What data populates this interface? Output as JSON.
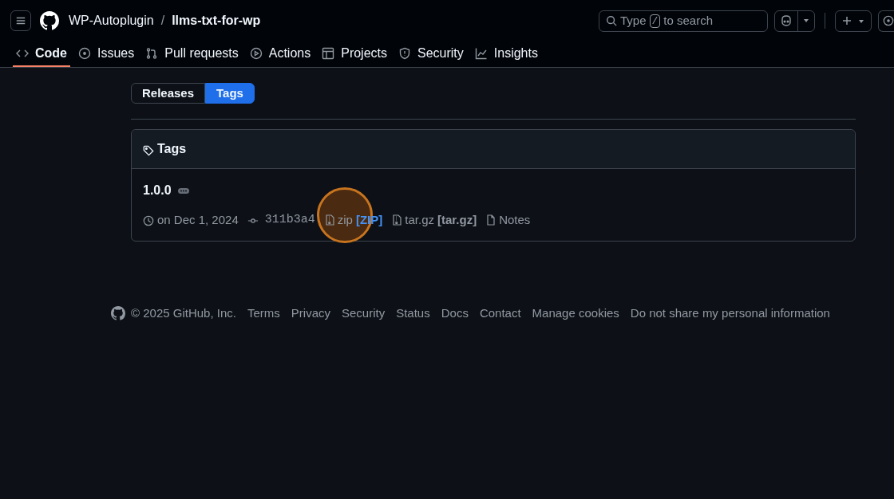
{
  "header": {
    "owner": "WP-Autoplugin",
    "separator": "/",
    "repo": "llms-txt-for-wp",
    "search": {
      "before": "Type",
      "key": "/",
      "after": "to search"
    }
  },
  "nav": [
    {
      "label": "Code",
      "kind": "code",
      "selected": true
    },
    {
      "label": "Issues",
      "kind": "issues",
      "selected": false
    },
    {
      "label": "Pull requests",
      "kind": "pulls",
      "selected": false
    },
    {
      "label": "Actions",
      "kind": "actions",
      "selected": false
    },
    {
      "label": "Projects",
      "kind": "projects",
      "selected": false
    },
    {
      "label": "Security",
      "kind": "security",
      "selected": false
    },
    {
      "label": "Insights",
      "kind": "insights",
      "selected": false
    }
  ],
  "switcher": [
    {
      "label": "Releases",
      "selected": false
    },
    {
      "label": "Tags",
      "selected": true
    }
  ],
  "tags_box": {
    "title": "Tags",
    "tags": [
      {
        "name": "1.0.0",
        "date": "on Dec 1, 2024",
        "commit": "311b3a4",
        "assets": [
          {
            "kind": "archive",
            "label": "zip",
            "format": "[ZIP]",
            "highlighted": true
          },
          {
            "kind": "archive",
            "label": "tar.gz",
            "format": "[tar.gz]",
            "highlighted": false
          },
          {
            "kind": "notes",
            "label": "Notes"
          }
        ]
      }
    ]
  },
  "footer": {
    "copyright": "© 2025 GitHub, Inc.",
    "links": [
      "Terms",
      "Privacy",
      "Security",
      "Status",
      "Docs",
      "Contact",
      "Manage cookies",
      "Do not share my personal information"
    ]
  }
}
